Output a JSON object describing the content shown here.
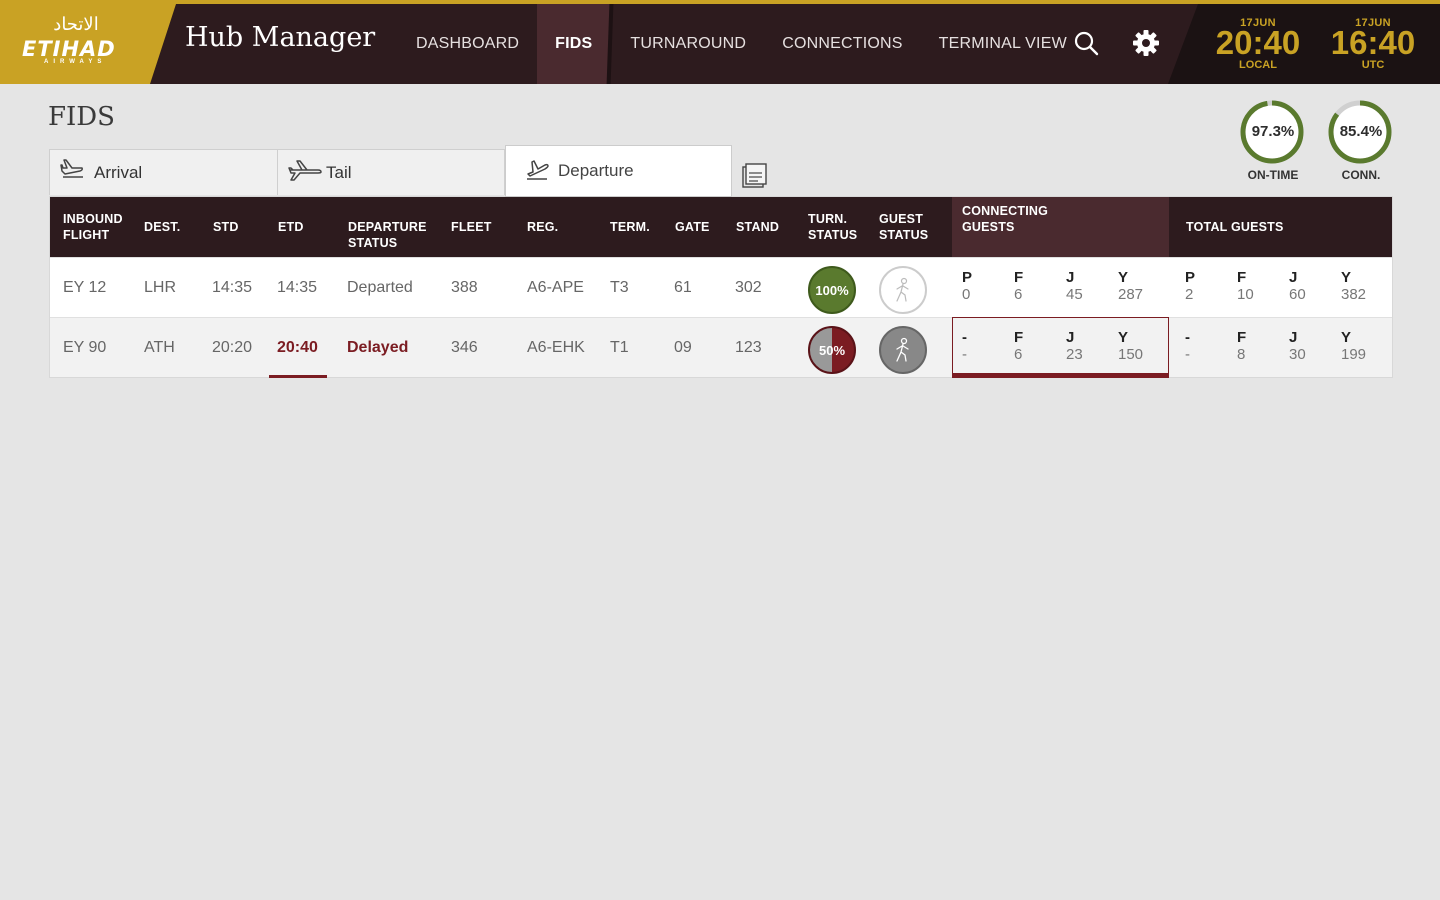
{
  "brand": {
    "arabic": "الاتحاد",
    "name": "ETIHAD",
    "sub": "AIRWAYS"
  },
  "app_title": "Hub Manager",
  "nav": [
    {
      "label": "DASHBOARD"
    },
    {
      "label": "FIDS"
    },
    {
      "label": "TURNAROUND"
    },
    {
      "label": "CONNECTIONS"
    },
    {
      "label": "TERMINAL VIEW"
    }
  ],
  "clocks": {
    "local": {
      "date": "17JUN",
      "time": "20:40",
      "label": "LOCAL"
    },
    "utc": {
      "date": "17JUN",
      "time": "16:40",
      "label": "UTC"
    }
  },
  "page_title": "FIDS",
  "kpis": {
    "ontime": {
      "value": "97.3%",
      "label": "ON-TIME",
      "fraction": 0.973
    },
    "conn": {
      "value": "85.4%",
      "label": "CONN.",
      "fraction": 0.854
    }
  },
  "tabs": {
    "arrival": "Arrival",
    "tail": "Tail",
    "departure": "Departure"
  },
  "columns": {
    "inbound": "INBOUND FLIGHT",
    "dest": "DEST.",
    "std": "STD",
    "etd": "ETD",
    "dep_status": "DEPARTURE STATUS",
    "fleet": "FLEET",
    "reg": "REG.",
    "term": "TERM.",
    "gate": "GATE",
    "stand": "STAND",
    "turn": "TURN. STATUS",
    "guest": "GUEST STATUS",
    "connecting": "CONNECTING GUESTS",
    "total": "TOTAL GUESTS"
  },
  "rows": [
    {
      "flight": "EY 12",
      "dest": "LHR",
      "std": "14:35",
      "etd": "14:35",
      "status": "Departed",
      "fleet": "388",
      "reg": "A6-APE",
      "term": "T3",
      "gate": "61",
      "stand": "302",
      "turn": "100%",
      "turn_fraction": 1.0,
      "connecting": {
        "P": "0",
        "F": "6",
        "J": "45",
        "Y": "287"
      },
      "total": {
        "P": "2",
        "F": "10",
        "J": "60",
        "Y": "382"
      },
      "class_labels": {
        "P": "P",
        "F": "F",
        "J": "J",
        "Y": "Y"
      }
    },
    {
      "flight": "EY 90",
      "dest": "ATH",
      "std": "20:20",
      "etd": "20:40",
      "status": "Delayed",
      "fleet": "346",
      "reg": "A6-EHK",
      "term": "T1",
      "gate": "09",
      "stand": "123",
      "turn": "50%",
      "turn_fraction": 0.5,
      "connecting": {
        "P": "-",
        "F": "6",
        "J": "23",
        "Y": "150"
      },
      "total": {
        "P": "-",
        "F": "8",
        "J": "30",
        "Y": "199"
      },
      "class_labels": {
        "P": "-",
        "F": "F",
        "J": "J",
        "Y": "Y"
      }
    }
  ],
  "colors": {
    "gold": "#c9a224",
    "header_bg": "#2d1b1e",
    "accent_red": "#7b1c22",
    "ok_green": "#5a7a2e"
  }
}
